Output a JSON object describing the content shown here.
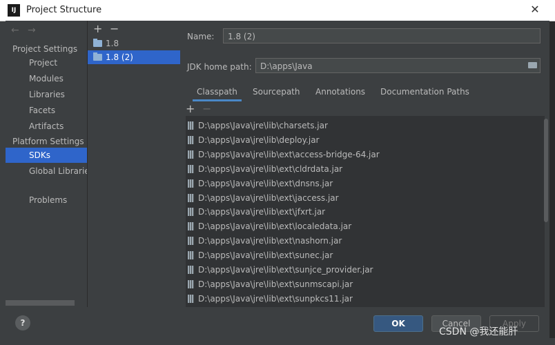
{
  "window": {
    "title": "Project Structure",
    "app_icon": "intellij-icon"
  },
  "nav": {
    "sections": [
      {
        "header": "Project Settings",
        "items": [
          "Project",
          "Modules",
          "Libraries",
          "Facets",
          "Artifacts"
        ]
      },
      {
        "header": "Platform Settings",
        "items": [
          "SDKs",
          "Global Libraries"
        ]
      }
    ],
    "problems": "Problems",
    "selected": "SDKs"
  },
  "sdks": {
    "items": [
      "1.8",
      "1.8 (2)"
    ],
    "selected": "1.8 (2)"
  },
  "detail": {
    "name_label": "Name:",
    "name_value": "1.8 (2)",
    "jdk_label": "JDK home path:",
    "jdk_value": "D:\\apps\\Java",
    "tabs": [
      "Classpath",
      "Sourcepath",
      "Annotations",
      "Documentation Paths"
    ],
    "selected_tab": "Classpath",
    "classpath": [
      "D:\\apps\\Java\\jre\\lib\\charsets.jar",
      "D:\\apps\\Java\\jre\\lib\\deploy.jar",
      "D:\\apps\\Java\\jre\\lib\\ext\\access-bridge-64.jar",
      "D:\\apps\\Java\\jre\\lib\\ext\\cldrdata.jar",
      "D:\\apps\\Java\\jre\\lib\\ext\\dnsns.jar",
      "D:\\apps\\Java\\jre\\lib\\ext\\jaccess.jar",
      "D:\\apps\\Java\\jre\\lib\\ext\\jfxrt.jar",
      "D:\\apps\\Java\\jre\\lib\\ext\\localedata.jar",
      "D:\\apps\\Java\\jre\\lib\\ext\\nashorn.jar",
      "D:\\apps\\Java\\jre\\lib\\ext\\sunec.jar",
      "D:\\apps\\Java\\jre\\lib\\ext\\sunjce_provider.jar",
      "D:\\apps\\Java\\jre\\lib\\ext\\sunmscapi.jar",
      "D:\\apps\\Java\\jre\\lib\\ext\\sunpkcs11.jar"
    ]
  },
  "buttons": {
    "ok": "OK",
    "cancel": "Cancel",
    "apply": "Apply",
    "help": "?"
  },
  "watermark": "CSDN @我还能肝",
  "colors": {
    "selection": "#2f65ca",
    "ok_button": "#365880",
    "tab_underline": "#4a88c7"
  }
}
